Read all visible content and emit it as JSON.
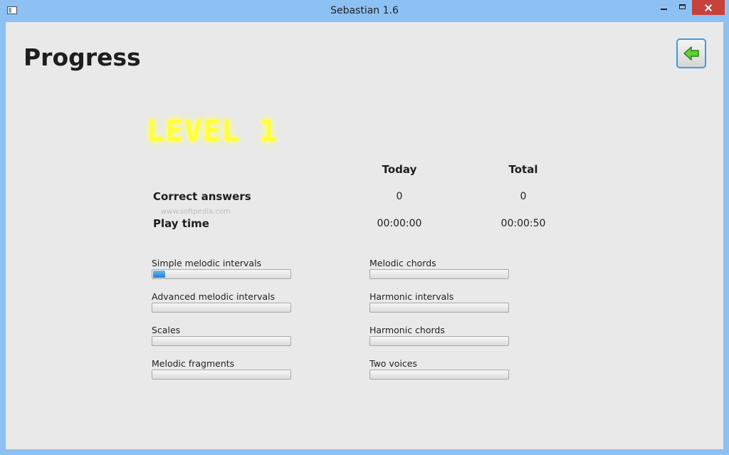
{
  "window": {
    "title": "Sebastian 1.6"
  },
  "page": {
    "title": "Progress",
    "back_button": "back-arrow-icon"
  },
  "level": {
    "label": "LEVEL 1"
  },
  "stats": {
    "col_today": "Today",
    "col_total": "Total",
    "rows": [
      {
        "label": "Correct answers",
        "today": "0",
        "total": "0"
      },
      {
        "label": "Play time",
        "today": "00:00:00",
        "total": "00:00:50"
      }
    ]
  },
  "watermark": "www.softpedia.com",
  "progress": {
    "left": [
      {
        "label": "Simple melodic intervals",
        "fraction": 0.09
      },
      {
        "label": "Advanced melodic intervals",
        "fraction": 0
      },
      {
        "label": "Scales",
        "fraction": 0
      },
      {
        "label": "Melodic fragments",
        "fraction": 0
      }
    ],
    "right": [
      {
        "label": "Melodic chords",
        "fraction": 0
      },
      {
        "label": "Harmonic intervals",
        "fraction": 0
      },
      {
        "label": "Harmonic chords",
        "fraction": 0
      },
      {
        "label": "Two voices",
        "fraction": 0
      }
    ]
  },
  "colors": {
    "level_text": "#ffff3c",
    "progress_fill": "#1e7fd6",
    "titlebar": "#8dc1f4"
  }
}
